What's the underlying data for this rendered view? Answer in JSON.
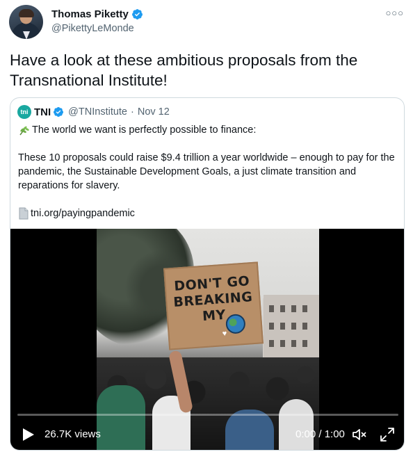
{
  "author": {
    "name": "Thomas Piketty",
    "handle": "@PikettyLeMonde",
    "verified": true,
    "more_icon": "more-icon"
  },
  "tweet": {
    "text": "Have a look at these ambitious proposals from the Transnational Institute!"
  },
  "quote": {
    "avatar_text": "tni",
    "name": "TNI",
    "handle": "@TNInstitute",
    "separator": "·",
    "date": "Nov 12",
    "line1": "The world we want is perfectly possible to finance:",
    "paragraph": "These 10 proposals could raise $9.4 trillion a year worldwide – enough to pay for the pandemic, the Sustainable Development Goals, a just climate transition and reparations for slavery.",
    "link": "tni.org/payingpandemic"
  },
  "video": {
    "sign_text": "DON'T GO BREAKING MY",
    "views": "26.7K views",
    "time": "0:00 / 1:00",
    "progress": 0.0
  },
  "colors": {
    "accent": "#1d9bf0",
    "secondary_text": "#536471",
    "border": "#cfd9de"
  }
}
